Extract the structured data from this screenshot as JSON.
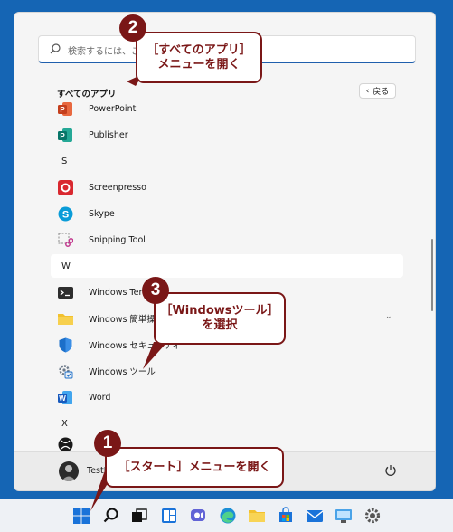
{
  "search": {
    "placeholder": "検索するには、ここ"
  },
  "all_apps": {
    "title": "すべてのアプリ",
    "back_label": "戻る"
  },
  "apps": [
    {
      "label": "PowerPoint",
      "icon": "powerpoint-icon",
      "color": "#c43e1c"
    },
    {
      "label": "Publisher",
      "icon": "publisher-icon",
      "color": "#077568"
    },
    {
      "letter": "S"
    },
    {
      "label": "Screenpresso",
      "icon": "screenpresso-icon",
      "color": "#d9282f"
    },
    {
      "label": "Skype",
      "icon": "skype-icon",
      "color": "#0a9cd8"
    },
    {
      "label": "Snipping Tool",
      "icon": "snipping-tool-icon",
      "color": "#c23a8f"
    },
    {
      "letter": "W"
    },
    {
      "label": "Windows Termi",
      "icon": "terminal-icon",
      "color": "#2d2d2d"
    },
    {
      "label": "Windows 簡単操作",
      "icon": "folder-icon",
      "color": "#f2c12e"
    },
    {
      "label": "Windows セキュリティ",
      "icon": "shield-icon",
      "color": "#1c6fc9"
    },
    {
      "label": "Windows ツール",
      "icon": "gear-icon",
      "color": "#6e7b8b"
    },
    {
      "label": "Word",
      "icon": "word-icon",
      "color": "#185abd"
    },
    {
      "letter": "X"
    }
  ],
  "user": {
    "name": "TestU"
  },
  "callouts": {
    "c1": {
      "badge": "1",
      "text": "［スタート］メニューを開く"
    },
    "c2": {
      "badge": "2",
      "line1": "［すべてのアプリ］",
      "line2": "メニューを開く"
    },
    "c3": {
      "badge": "3",
      "line1": "［Windowsツール］",
      "line2": "を選択"
    }
  },
  "colors": {
    "accent": "#1f5fad",
    "callout": "#7a1717",
    "desktop": "#1565b4"
  }
}
